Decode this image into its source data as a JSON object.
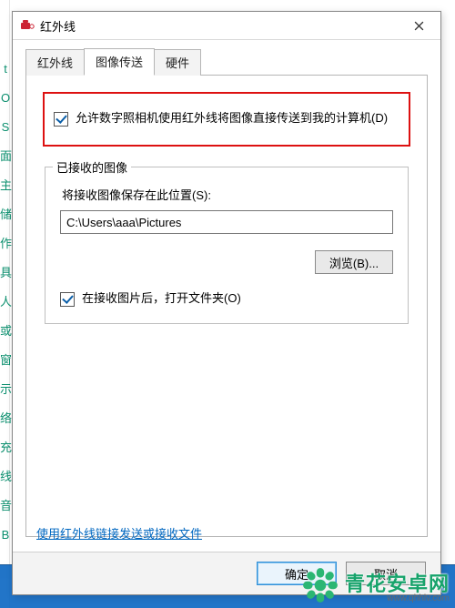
{
  "gutter_letters": "t\nO\nS\n面\n主\n储\n作\n具\n人\n或\n窗\n示\n络\n充\n线\n音\nB",
  "window": {
    "title": "红外线"
  },
  "tabs": {
    "t1": "红外线",
    "t2": "图像传送",
    "t3": "硬件",
    "active_index": 1
  },
  "allow_camera": {
    "label": "允许数字照相机使用红外线将图像直接传送到我的计算机(D)",
    "checked": true
  },
  "received": {
    "legend": "已接收的图像",
    "save_label": "将接收图像保存在此位置(S):",
    "path_value": "C:\\Users\\aaa\\Pictures",
    "browse_label": "浏览(B)...",
    "open_after_label": "在接收图片后，打开文件夹(O)",
    "open_after_checked": true
  },
  "footer_link": {
    "text": "使用红外线链接发送或接收文件"
  },
  "buttons": {
    "ok": "确定",
    "cancel": "取消"
  },
  "watermark": {
    "brand": "青花安卓网",
    "domain": "www.qhhlv.com"
  }
}
